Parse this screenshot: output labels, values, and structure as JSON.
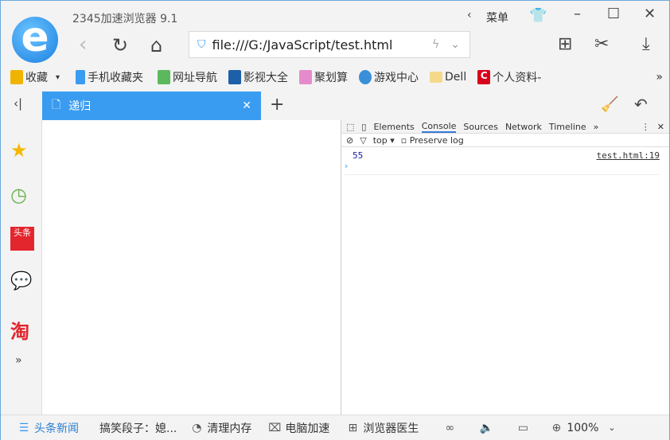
{
  "window": {
    "title": "2345加速浏览器 9.1",
    "menu_label": "菜单"
  },
  "address": {
    "url": "file:///G:/JavaScript/test.html"
  },
  "bookmarks": [
    {
      "label": "收藏",
      "color": "#f0b400"
    },
    {
      "label": "手机收藏夹",
      "color": "#3a9cf0"
    },
    {
      "label": "网址导航",
      "color": "#5cb85c"
    },
    {
      "label": "影视大全",
      "color": "#1d5fa8"
    },
    {
      "label": "聚划算",
      "color": "#e48ccb"
    },
    {
      "label": "游戏中心",
      "color": "#3a8fd8"
    },
    {
      "label": "Dell",
      "color": "#f5d98a"
    },
    {
      "label": "个人资料-",
      "color": "#d9001b"
    }
  ],
  "tab": {
    "title": "递归"
  },
  "devtools": {
    "tabs": [
      "Elements",
      "Console",
      "Sources",
      "Network",
      "Timeline"
    ],
    "active_tab": "Console",
    "context": "top",
    "preserve_log": "Preserve log",
    "log_value": "55",
    "log_source": "test.html:19",
    "prompt": "›"
  },
  "sidebar": [
    {
      "icon": "star-icon"
    },
    {
      "icon": "clock-icon"
    },
    {
      "icon": "news-icon",
      "label": "头条"
    },
    {
      "icon": "chat-icon"
    },
    {
      "icon": "taobao-icon",
      "label": "淘"
    }
  ],
  "statusbar": {
    "news": "头条新闻",
    "joke": "搞笑段子：媳...",
    "clean": "清理内存",
    "speed": "电脑加速",
    "doctor": "浏览器医生",
    "zoom": "100%"
  }
}
